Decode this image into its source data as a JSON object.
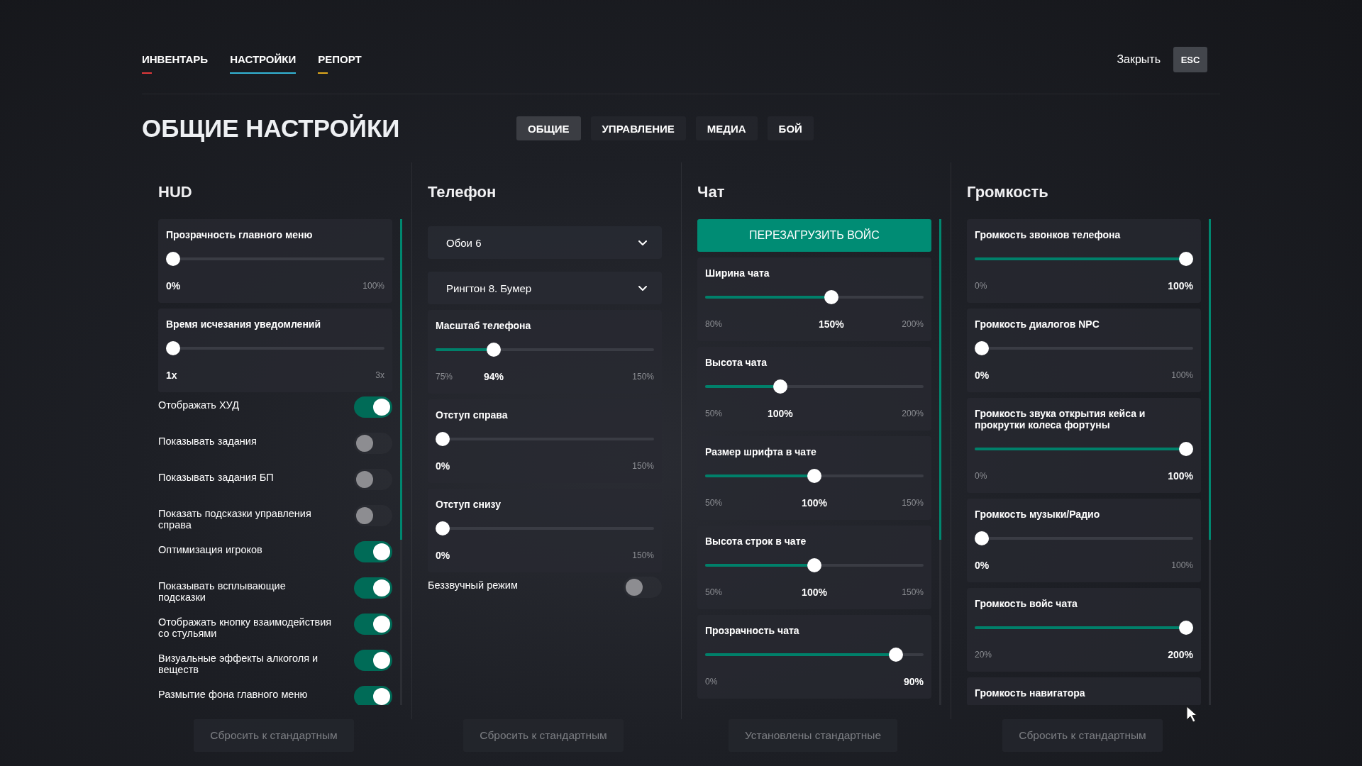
{
  "nav": {
    "tabs": [
      {
        "label": "ИНВЕНТАРЬ",
        "selected": false,
        "color": "#e0383a"
      },
      {
        "label": "НАСТРОЙКИ",
        "selected": true,
        "color": "#33b5d6"
      },
      {
        "label": "РЕПОРТ",
        "selected": false,
        "color": "#e0a81c"
      }
    ],
    "close_label": "Закрыть",
    "close_key": "ESC"
  },
  "title": "ОБЩИЕ НАСТРОЙКИ",
  "subtabs": [
    {
      "label": "ОБЩИЕ",
      "selected": true
    },
    {
      "label": "УПРАВЛЕНИЕ",
      "selected": false
    },
    {
      "label": "МЕДИА",
      "selected": false
    },
    {
      "label": "БОЙ",
      "selected": false
    }
  ],
  "columns": [
    {
      "title": "HUD",
      "scrollable": true,
      "reset": "Сбросить к стандартным",
      "items": [
        {
          "kind": "slider",
          "label": "Прозрачность главного меню",
          "level": 0,
          "value": "0%",
          "max": "100%"
        },
        {
          "kind": "slider",
          "label": "Время исчезания уведомлений",
          "level": 0,
          "value": "1x",
          "max": "3x"
        },
        {
          "kind": "toggle",
          "label": "Отображать ХУД",
          "on": true
        },
        {
          "kind": "toggle",
          "label": "Показывать задания",
          "on": false
        },
        {
          "kind": "toggle",
          "label": "Показывать задания БП",
          "on": false
        },
        {
          "kind": "toggle",
          "label": "Показать подсказки управления справа",
          "on": false
        },
        {
          "kind": "toggle",
          "label": "Оптимизация игроков",
          "on": true
        },
        {
          "kind": "toggle",
          "label": "Показывать всплывающие подсказки",
          "on": true
        },
        {
          "kind": "toggle",
          "label": "Отображать кнопку взаимодействия со стульями",
          "on": true
        },
        {
          "kind": "toggle",
          "label": "Визуальные эффекты алкоголя и веществ",
          "on": true
        },
        {
          "kind": "toggle",
          "label": "Размытие фона главного меню",
          "on": true
        }
      ]
    },
    {
      "title": "Телефон",
      "scrollable": false,
      "reset": "Сбросить к стандартным",
      "items": [
        {
          "kind": "dropdown",
          "label": "Обои 6"
        },
        {
          "kind": "dropdown",
          "label": "Рингтон 8. Бумер"
        },
        {
          "kind": "slider",
          "label": "Масштаб телефона",
          "level": 0.25,
          "min": "75%",
          "value": "94%",
          "max": "150%"
        },
        {
          "kind": "slider",
          "label": "Отступ справа",
          "level": 0,
          "value": "0%",
          "max": "150%"
        },
        {
          "kind": "slider",
          "label": "Отступ снизу",
          "level": 0,
          "value": "0%",
          "max": "150%"
        },
        {
          "kind": "toggle",
          "label": "Беззвучный режим",
          "on": false
        }
      ]
    },
    {
      "title": "Чат",
      "scrollable": true,
      "reset": "Установлены стандартные",
      "items": [
        {
          "kind": "action",
          "label": "ПЕРЕЗАГРУЗИТЬ ВОЙС"
        },
        {
          "kind": "slider",
          "label": "Ширина чата",
          "level": 0.583,
          "min": "80%",
          "value": "150%",
          "max": "200%"
        },
        {
          "kind": "slider",
          "label": "Высота чата",
          "level": 0.333,
          "min": "50%",
          "value": "100%",
          "max": "200%"
        },
        {
          "kind": "slider",
          "label": "Размер шрифта в чате",
          "level": 0.5,
          "min": "50%",
          "value": "100%",
          "max": "150%"
        },
        {
          "kind": "slider",
          "label": "Высота строк в чате",
          "level": 0.5,
          "min": "50%",
          "value": "100%",
          "max": "150%"
        },
        {
          "kind": "slider",
          "label": "Прозрачность чата",
          "level": 0.9,
          "min": "0%",
          "value": "90%"
        }
      ]
    },
    {
      "title": "Громкость",
      "scrollable": true,
      "reset": "Сбросить к стандартным",
      "items": [
        {
          "kind": "slider",
          "label": "Громкость звонков телефона",
          "level": 1,
          "min": "0%",
          "value": "100%"
        },
        {
          "kind": "slider",
          "label": "Громкость диалогов NPC",
          "level": 0,
          "value": "0%",
          "max": "100%"
        },
        {
          "kind": "slider",
          "label": "Громкость звука открытия кейса и прокрутки колеса фортуны",
          "level": 1,
          "min": "0%",
          "value": "100%"
        },
        {
          "kind": "slider",
          "label": "Громкость музыки/Радио",
          "level": 0,
          "value": "0%",
          "max": "100%"
        },
        {
          "kind": "slider",
          "label": "Громкость войс чата",
          "level": 1,
          "min": "20%",
          "value": "200%"
        },
        {
          "kind": "partial",
          "label": "Громкость навигатора"
        }
      ]
    }
  ]
}
